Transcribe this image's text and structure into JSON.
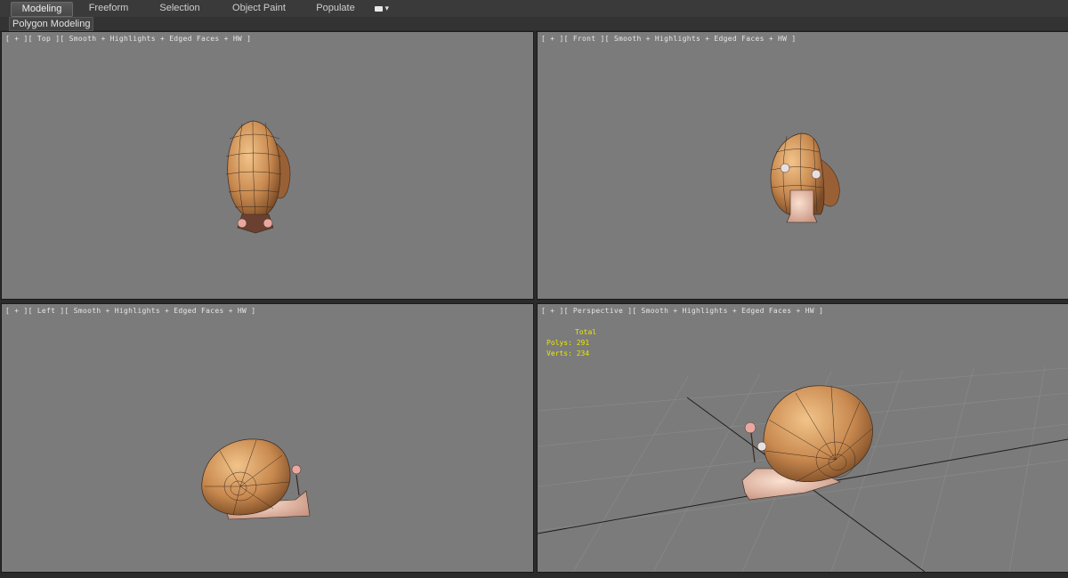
{
  "ribbon": {
    "tabs": [
      {
        "label": "Modeling",
        "active": true
      },
      {
        "label": "Freeform",
        "active": false
      },
      {
        "label": "Selection",
        "active": false
      },
      {
        "label": "Object Paint",
        "active": false
      },
      {
        "label": "Populate",
        "active": false
      }
    ],
    "sub_panel_label": "Polygon Modeling"
  },
  "viewports": {
    "top": {
      "label": "[ + ][ Top ][ Smooth + Highlights + Edged Faces + HW ]"
    },
    "front": {
      "label": "[ + ][ Front ][ Smooth + Highlights + Edged Faces + HW ]"
    },
    "left": {
      "label": "[ + ][ Left ][ Smooth + Highlights + Edged Faces + HW ]"
    },
    "perspective": {
      "label": "[ + ][ Perspective ][ Smooth + Highlights + Edged Faces + HW ]",
      "stats": {
        "heading": "Total",
        "polys": "Polys: 291",
        "verts": "Verts: 234"
      }
    }
  },
  "colors": {
    "viewport_bg": "#7b7b7b",
    "shell": "#c8894f",
    "body": "#e8b8a0",
    "wire": "#3a2a20",
    "stats_text": "#e8e800"
  }
}
